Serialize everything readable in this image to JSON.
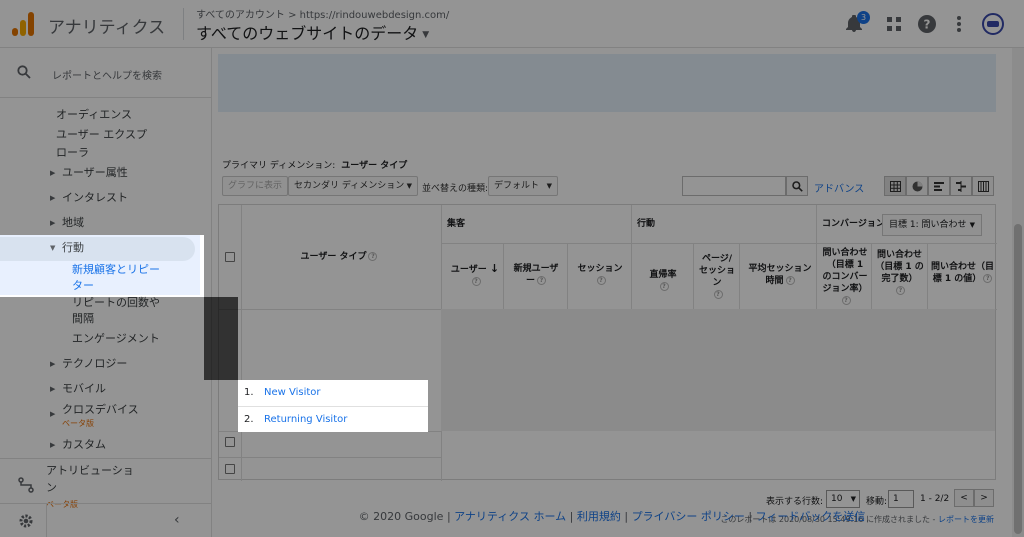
{
  "header": {
    "product_name": "アナリティクス",
    "account_crumb": "すべてのアカウント > https://rindouwebdesign.com/",
    "view_title": "すべてのウェブサイトのデータ",
    "notification_count": "3",
    "icons": [
      "bell-icon",
      "apps-icon",
      "help-icon",
      "more-vert-icon",
      "avatar"
    ]
  },
  "sidebar": {
    "search_label": "レポートとヘルプを検索",
    "items": [
      {
        "label": "オーディエンス"
      },
      {
        "label": "ユーザー エクスプ"
      },
      {
        "label": "ローラ"
      },
      {
        "label": "ユーザー属性"
      },
      {
        "label": "インタレスト"
      },
      {
        "label": "地域"
      },
      {
        "label": "行動"
      },
      {
        "label": "新規顧客とリピー"
      },
      {
        "label": "ター"
      },
      {
        "label": "リピートの回数や"
      },
      {
        "label": "間隔"
      },
      {
        "label": "エンゲージメント"
      },
      {
        "label": "テクノロジー"
      },
      {
        "label": "モバイル"
      },
      {
        "label": "クロスデバイス"
      },
      {
        "label": "ベータ版"
      },
      {
        "label": "カスタム"
      }
    ],
    "attribution_label_1": "アトリビューショ",
    "attribution_label_2": "ン",
    "attribution_beta": "ベータ版"
  },
  "toolbar": {
    "primary_dimension_label": "プライマリ ディメンション:",
    "primary_dimension_value": "ユーザー タイプ",
    "graph_button": "グラフに表示",
    "secondary_dimension": "セカンダリ ディメンション",
    "sort_label": "並べ替えの種類:",
    "sort_value": "デフォルト",
    "advanced_link": "アドバンス"
  },
  "table": {
    "dimension_header": "ユーザー タイプ",
    "group_acquisition": "集客",
    "group_behavior": "行動",
    "group_conversion": "コンバージョン",
    "goal_select": "目標 1: 問い合わせ",
    "columns": {
      "users": "ユーザー",
      "new_users_1": "新規ユーザ",
      "new_users_2": "ー",
      "sessions": "セッション",
      "bounce_rate": "直帰率",
      "pages_1": "ページ/",
      "pages_2": "セッション",
      "avg_duration_1": "平均セッション",
      "avg_duration_2": "時間",
      "goal_cvr_1": "問い合わせ",
      "goal_cvr_2": "（目標 1",
      "goal_cvr_3": "のコンバー",
      "goal_cvr_4": "ジョン率）",
      "goal_completions_1": "問い合わせ",
      "goal_completions_2": "（目標 1 の",
      "goal_completions_3": "完了数）",
      "goal_value_1": "問い合わせ（目",
      "goal_value_2": "標 1 の値）"
    },
    "rows": [
      {
        "num": "1.",
        "label": "New Visitor"
      },
      {
        "num": "2.",
        "label": "Returning Visitor"
      }
    ]
  },
  "pager": {
    "rows_label": "表示する行数:",
    "rows_value": "10",
    "goto_label": "移動:",
    "goto_value": "1",
    "range": "1 - 2/2",
    "prev": "<",
    "next": ">"
  },
  "report_created": "このレポートは 2020/08/30 15:49:16 に作成されました -",
  "refresh_link": "レポートを更新",
  "footer": {
    "copyright": "© 2020 Google",
    "sep": "|",
    "home": "アナリティクス ホーム",
    "terms": "利用規約",
    "privacy": "プライバシー ポリシー",
    "feedback": "フィードバックを送信"
  }
}
